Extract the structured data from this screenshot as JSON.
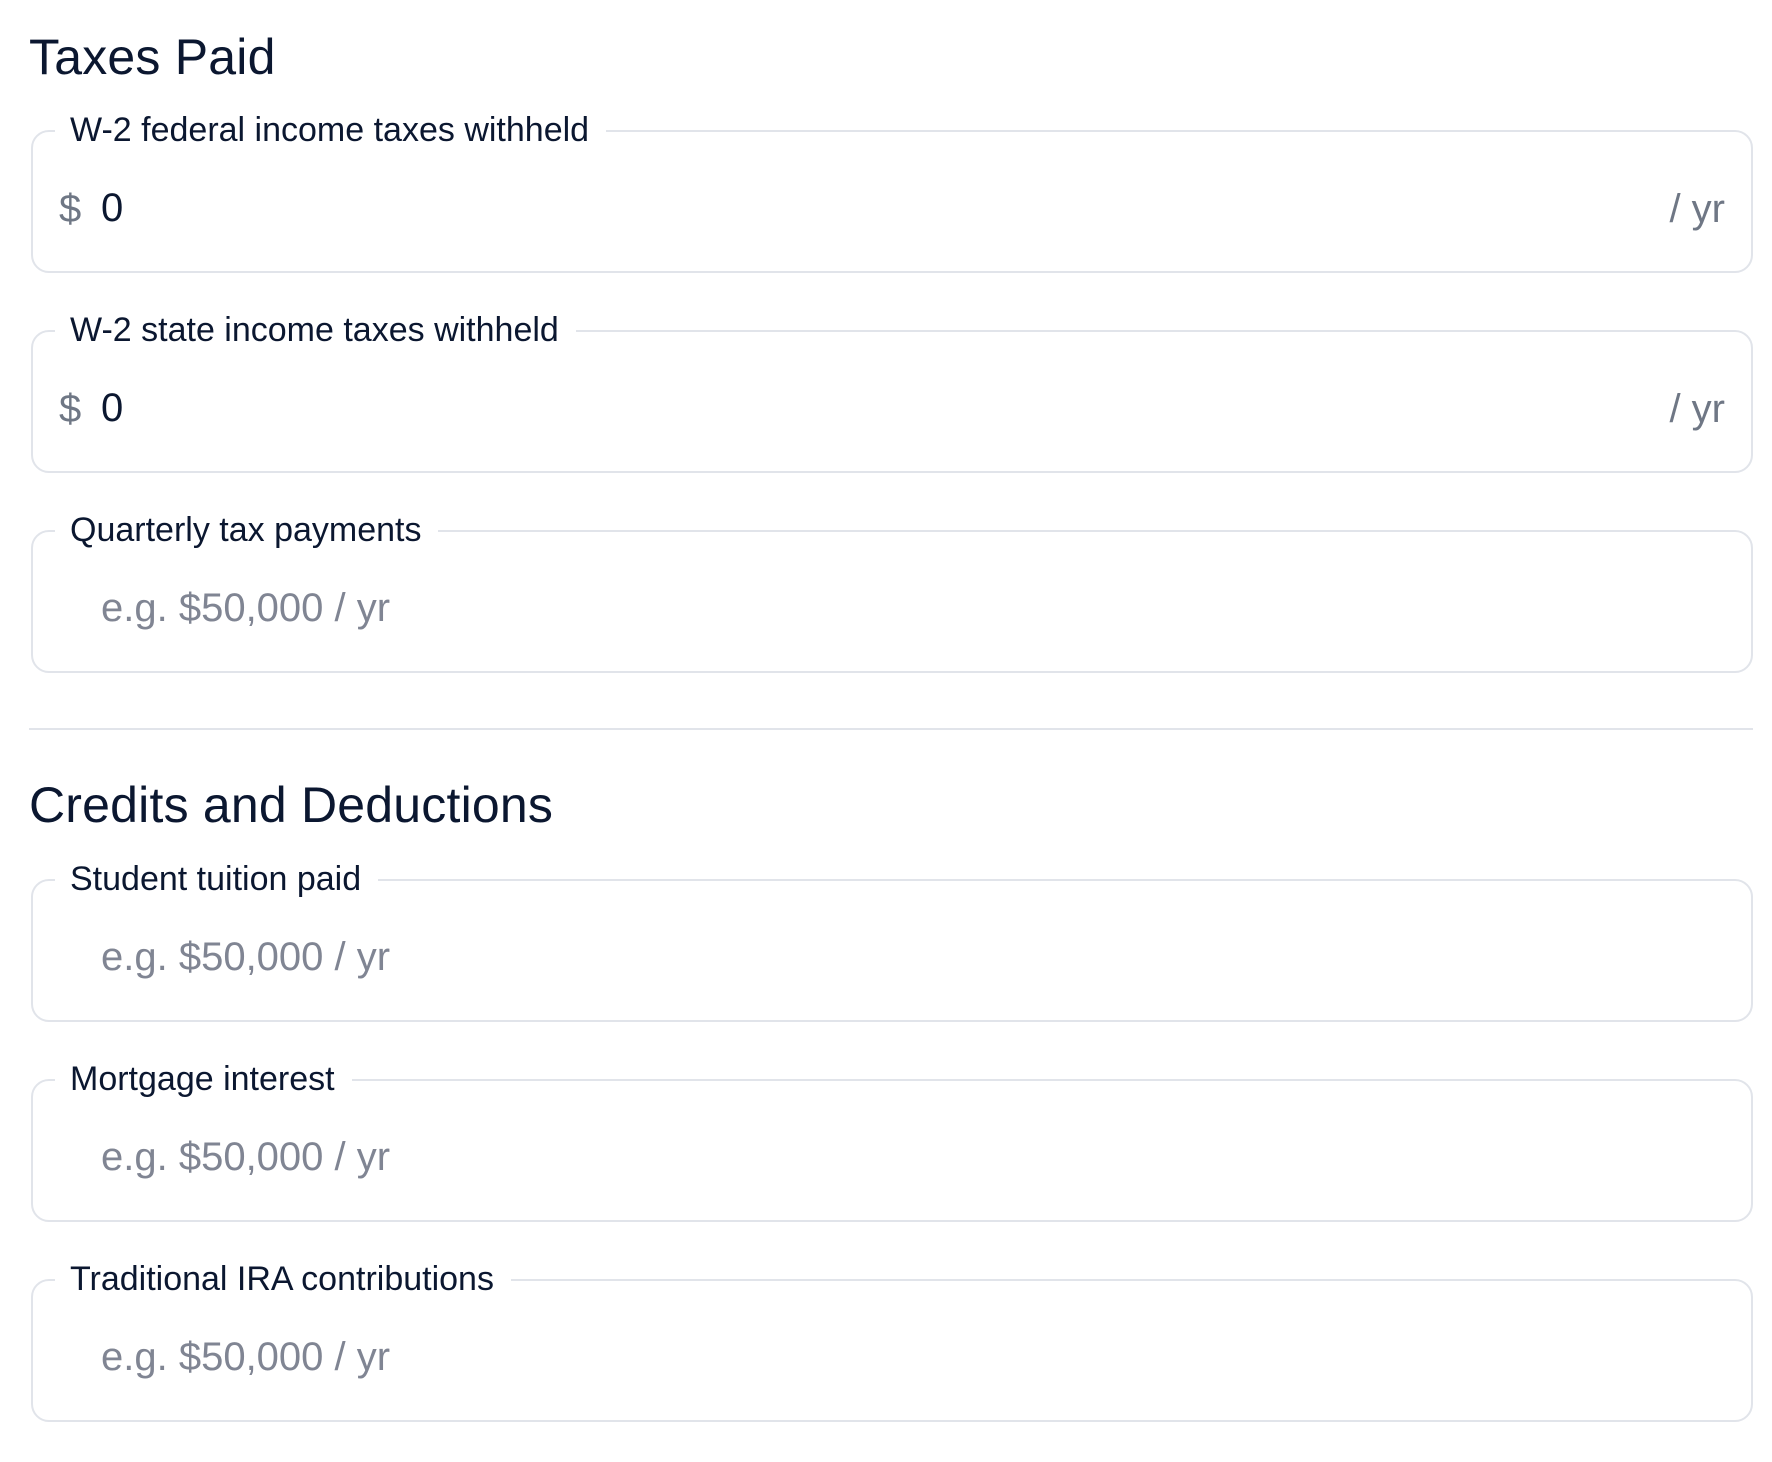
{
  "taxes_paid": {
    "title": "Taxes Paid",
    "fields": [
      {
        "label": "W-2 federal income taxes withheld",
        "prefix": "$",
        "value": "0",
        "suffix": "/ yr"
      },
      {
        "label": "W-2 state income taxes withheld",
        "prefix": "$",
        "value": "0",
        "suffix": "/ yr"
      },
      {
        "label": "Quarterly tax payments",
        "value": "",
        "placeholder": "e.g. $50,000 / yr"
      }
    ]
  },
  "credits_deductions": {
    "title": "Credits and Deductions",
    "fields": [
      {
        "label": "Student tuition paid",
        "value": "",
        "placeholder": "e.g. $50,000 / yr"
      },
      {
        "label": "Mortgage interest",
        "value": "",
        "placeholder": "e.g. $50,000 / yr"
      },
      {
        "label": "Traditional IRA contributions",
        "value": "",
        "placeholder": "e.g. $50,000 / yr"
      }
    ]
  },
  "colors": {
    "text": "#0b1730",
    "muted": "#6f7785",
    "placeholder": "#808593",
    "border": "#e1e4ea"
  }
}
